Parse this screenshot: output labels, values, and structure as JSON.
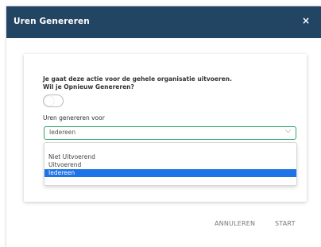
{
  "dialog": {
    "title": "Uren Genereren",
    "close_symbol": "×"
  },
  "form": {
    "warning_text": "Je gaat deze actie voor de gehele organisatie uitvoeren.",
    "regenerate_label": "Wil je Opnieuw Genereren?",
    "regenerate_toggle_on": false,
    "generate_for_label": "Uren genereren voor",
    "selected_value": "Iedereen",
    "chevron_symbol": "⌵"
  },
  "dropdown": {
    "options": [
      {
        "label": "Niet Uitvoerend"
      },
      {
        "label": "Uitvoerend"
      },
      {
        "label": "Iedereen"
      }
    ],
    "highlighted_index": 2
  },
  "footer": {
    "cancel_label": "ANNULEREN",
    "start_label": "START"
  },
  "colors": {
    "header_bg": "#234564",
    "select_border": "#2fa86b",
    "highlight": "#1e73e8"
  }
}
